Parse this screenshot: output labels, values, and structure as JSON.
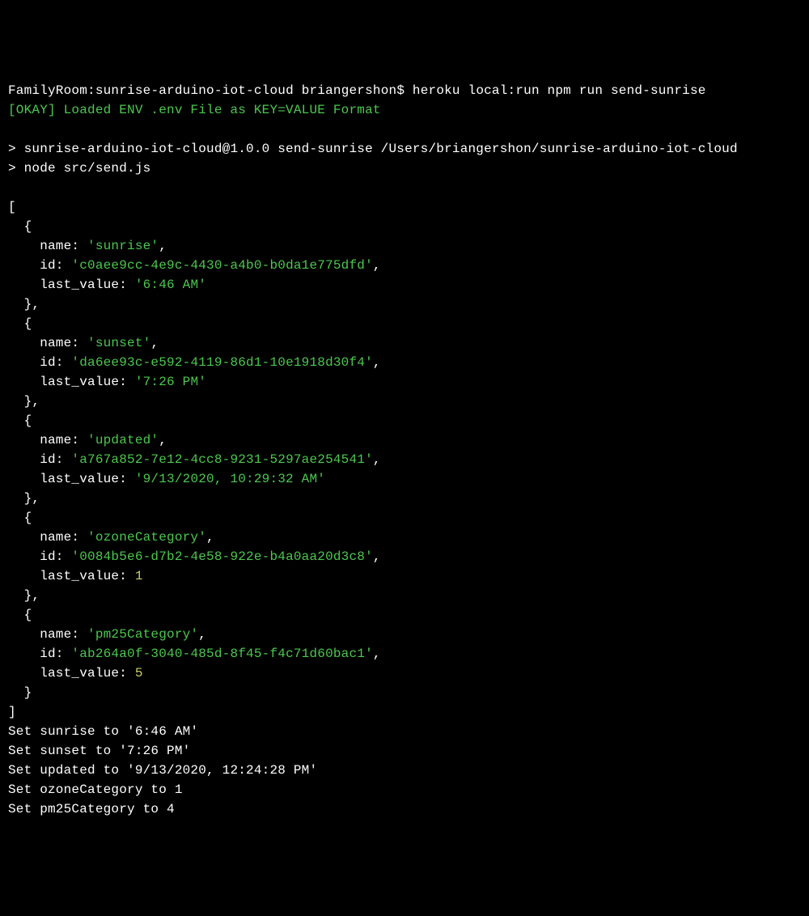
{
  "prompt": {
    "host": "FamilyRoom",
    "path": "sunrise-arduino-iot-cloud",
    "user": "briangershon",
    "command": "heroku local:run npm run send-sunrise"
  },
  "okay_line": "[OKAY] Loaded ENV .env File as KEY=VALUE Format",
  "npm_script_line": "> sunrise-arduino-iot-cloud@1.0.0 send-sunrise /Users/briangershon/sunrise-arduino-iot-cloud",
  "node_line": "> node src/send.js",
  "array": {
    "open": "[",
    "close": "]",
    "items": [
      {
        "name_key": "    name: ",
        "name_val": "'sunrise'",
        "name_comma": ",",
        "id_key": "    id: ",
        "id_val": "'c0aee9cc-4e9c-4430-a4b0-b0da1e775dfd'",
        "id_comma": ",",
        "lv_key": "    last_value: ",
        "lv_val": "'6:46 AM'",
        "lv_is_string": true
      },
      {
        "name_key": "    name: ",
        "name_val": "'sunset'",
        "name_comma": ",",
        "id_key": "    id: ",
        "id_val": "'da6ee93c-e592-4119-86d1-10e1918d30f4'",
        "id_comma": ",",
        "lv_key": "    last_value: ",
        "lv_val": "'7:26 PM'",
        "lv_is_string": true
      },
      {
        "name_key": "    name: ",
        "name_val": "'updated'",
        "name_comma": ",",
        "id_key": "    id: ",
        "id_val": "'a767a852-7e12-4cc8-9231-5297ae254541'",
        "id_comma": ",",
        "lv_key": "    last_value: ",
        "lv_val": "'9/13/2020, 10:29:32 AM'",
        "lv_is_string": true
      },
      {
        "name_key": "    name: ",
        "name_val": "'ozoneCategory'",
        "name_comma": ",",
        "id_key": "    id: ",
        "id_val": "'0084b5e6-d7b2-4e58-922e-b4a0aa20d3c8'",
        "id_comma": ",",
        "lv_key": "    last_value: ",
        "lv_val": "1",
        "lv_is_string": false
      },
      {
        "name_key": "    name: ",
        "name_val": "'pm25Category'",
        "name_comma": ",",
        "id_key": "    id: ",
        "id_val": "'ab264a0f-3040-485d-8f45-f4c71d60bac1'",
        "id_comma": ",",
        "lv_key": "    last_value: ",
        "lv_val": "5",
        "lv_is_string": false
      }
    ]
  },
  "footer": {
    "l1": "Set sunrise to '6:46 AM'",
    "l2": "Set sunset to '7:26 PM'",
    "l3": "Set updated to '9/13/2020, 12:24:28 PM'",
    "l4": "Set ozoneCategory to 1",
    "l5": "Set pm25Category to 4"
  }
}
